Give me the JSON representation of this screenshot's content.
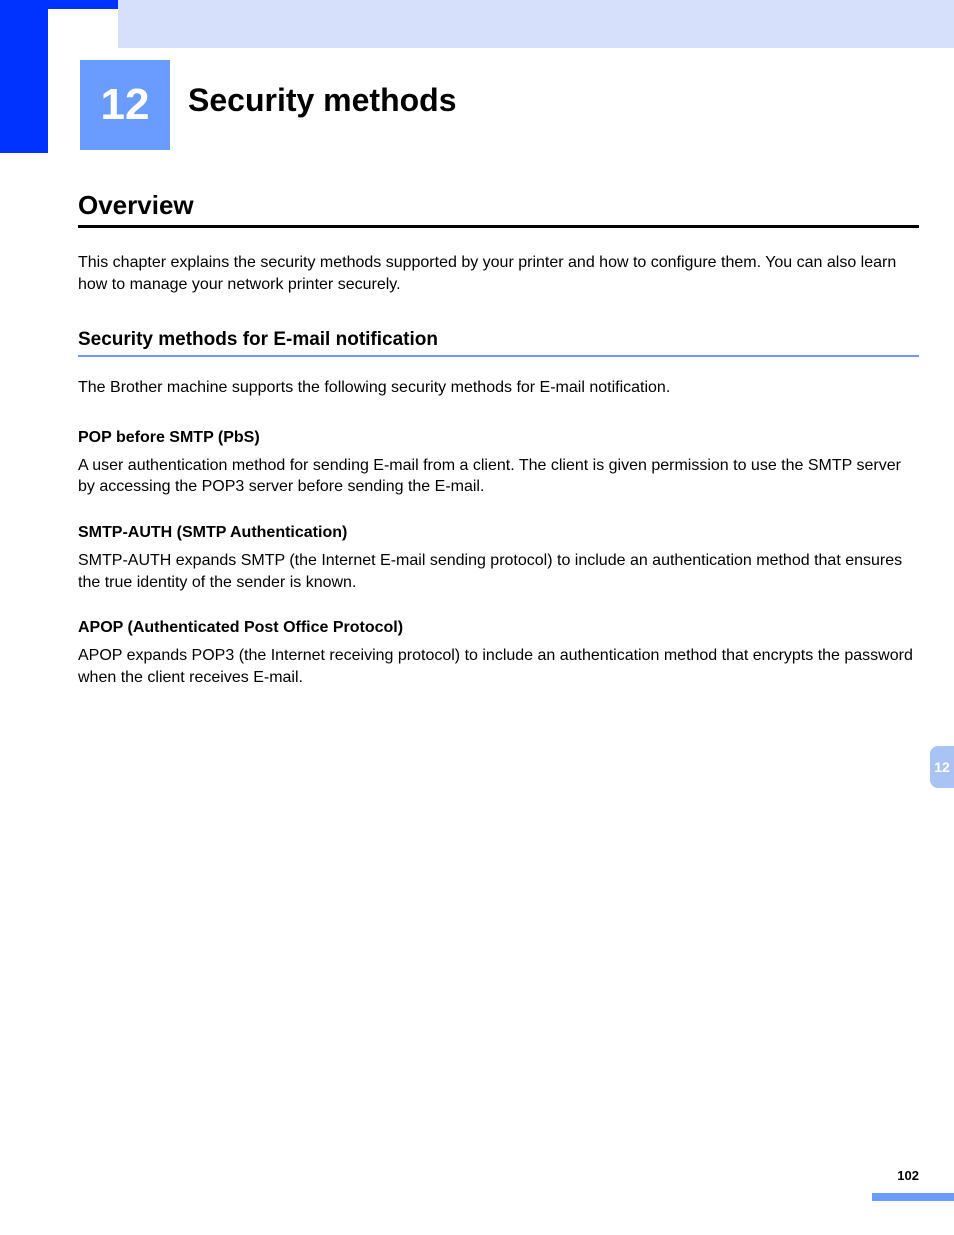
{
  "chapter": {
    "number": "12",
    "title": "Security methods"
  },
  "section": {
    "heading": "Overview",
    "intro": "This chapter explains the security methods supported by your printer and how to configure them. You can also learn how to manage your network printer securely."
  },
  "subsection": {
    "heading": "Security methods for E-mail notification",
    "intro": "The Brother machine supports the following security methods for E-mail notification."
  },
  "methods": [
    {
      "title": "POP before SMTP (PbS)",
      "body": "A user authentication method for sending E-mail from a client. The client is given permission to use the SMTP server by accessing the POP3 server before sending the E-mail."
    },
    {
      "title": "SMTP-AUTH (SMTP Authentication)",
      "body": "SMTP-AUTH expands SMTP (the Internet E-mail sending protocol) to include an authentication method that ensures the true identity of the sender is known."
    },
    {
      "title": "APOP (Authenticated Post Office Protocol)",
      "body": "APOP expands POP3 (the Internet receiving protocol) to include an authentication method that encrypts the password when the client receives E-mail."
    }
  ],
  "sideTab": "12",
  "pageNumber": "102"
}
